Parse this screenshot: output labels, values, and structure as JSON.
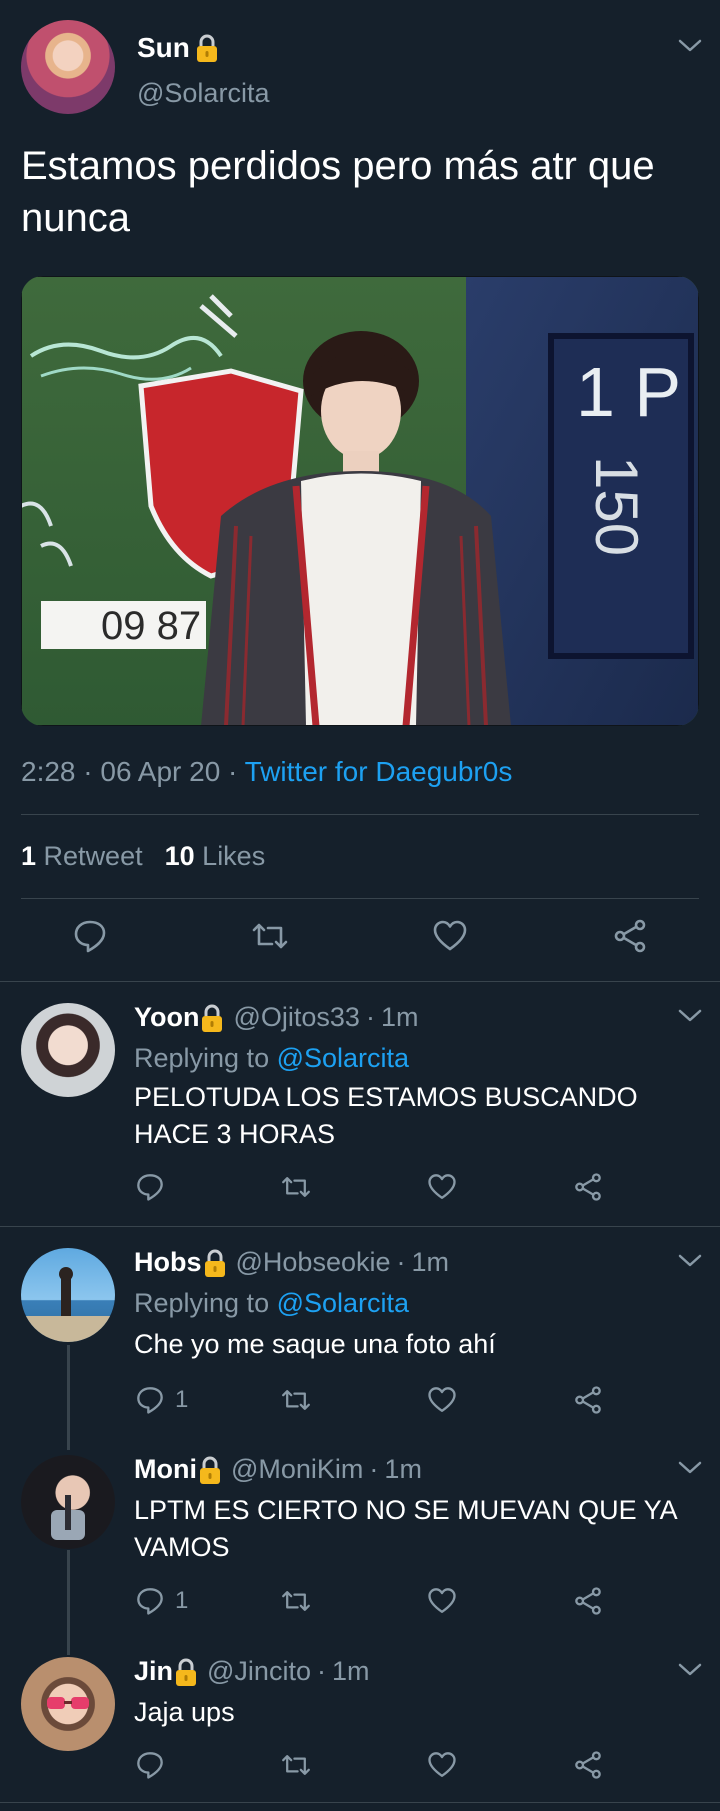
{
  "tweet": {
    "name": "Sun",
    "handle": "@Solarcita",
    "text": "Estamos perdidos pero más atr que nunca",
    "photo_text": {
      "sign": "09 87",
      "wall_numbers": "1 P",
      "wall_numbers_2": "150"
    },
    "time": "2:28",
    "date": "06 Apr 20",
    "source": "Twitter for Daegubr0s",
    "retweets_count": "1",
    "retweets_label": "Retweet",
    "likes_count": "10",
    "likes_label": "Likes"
  },
  "replies": [
    {
      "name": "Yoon",
      "handle": "@Ojitos33",
      "time": "1m",
      "replying_to_label": "Replying to",
      "replying_to_handle": "@Solarcita",
      "text": "PELOTUDA LOS ESTAMOS BUSCANDO HACE 3 HORAS",
      "reply_count": ""
    },
    {
      "name": "Hobs",
      "handle": "@Hobseokie",
      "time": "1m",
      "replying_to_label": "Replying to",
      "replying_to_handle": "@Solarcita",
      "text": "Che yo me saque una foto ahí",
      "reply_count": "1"
    },
    {
      "name": "Moni",
      "handle": "@MoniKim",
      "time": "1m",
      "text": "LPTM ES CIERTO NO SE MUEVAN QUE YA VAMOS",
      "reply_count": "1"
    },
    {
      "name": "Jin",
      "handle": "@Jincito",
      "time": "1m",
      "text": "Jaja ups",
      "reply_count": ""
    }
  ],
  "separator": "·",
  "icons": {
    "lock": "lock-icon",
    "chevron": "chevron-down-icon",
    "reply": "reply-icon",
    "retweet": "retweet-icon",
    "like": "heart-icon",
    "share": "share-icon"
  },
  "colors": {
    "background": "#15202b",
    "secondary_text": "#8899a6",
    "link": "#1da1f2",
    "divider": "#38444d",
    "lock": "#f5b81c"
  }
}
